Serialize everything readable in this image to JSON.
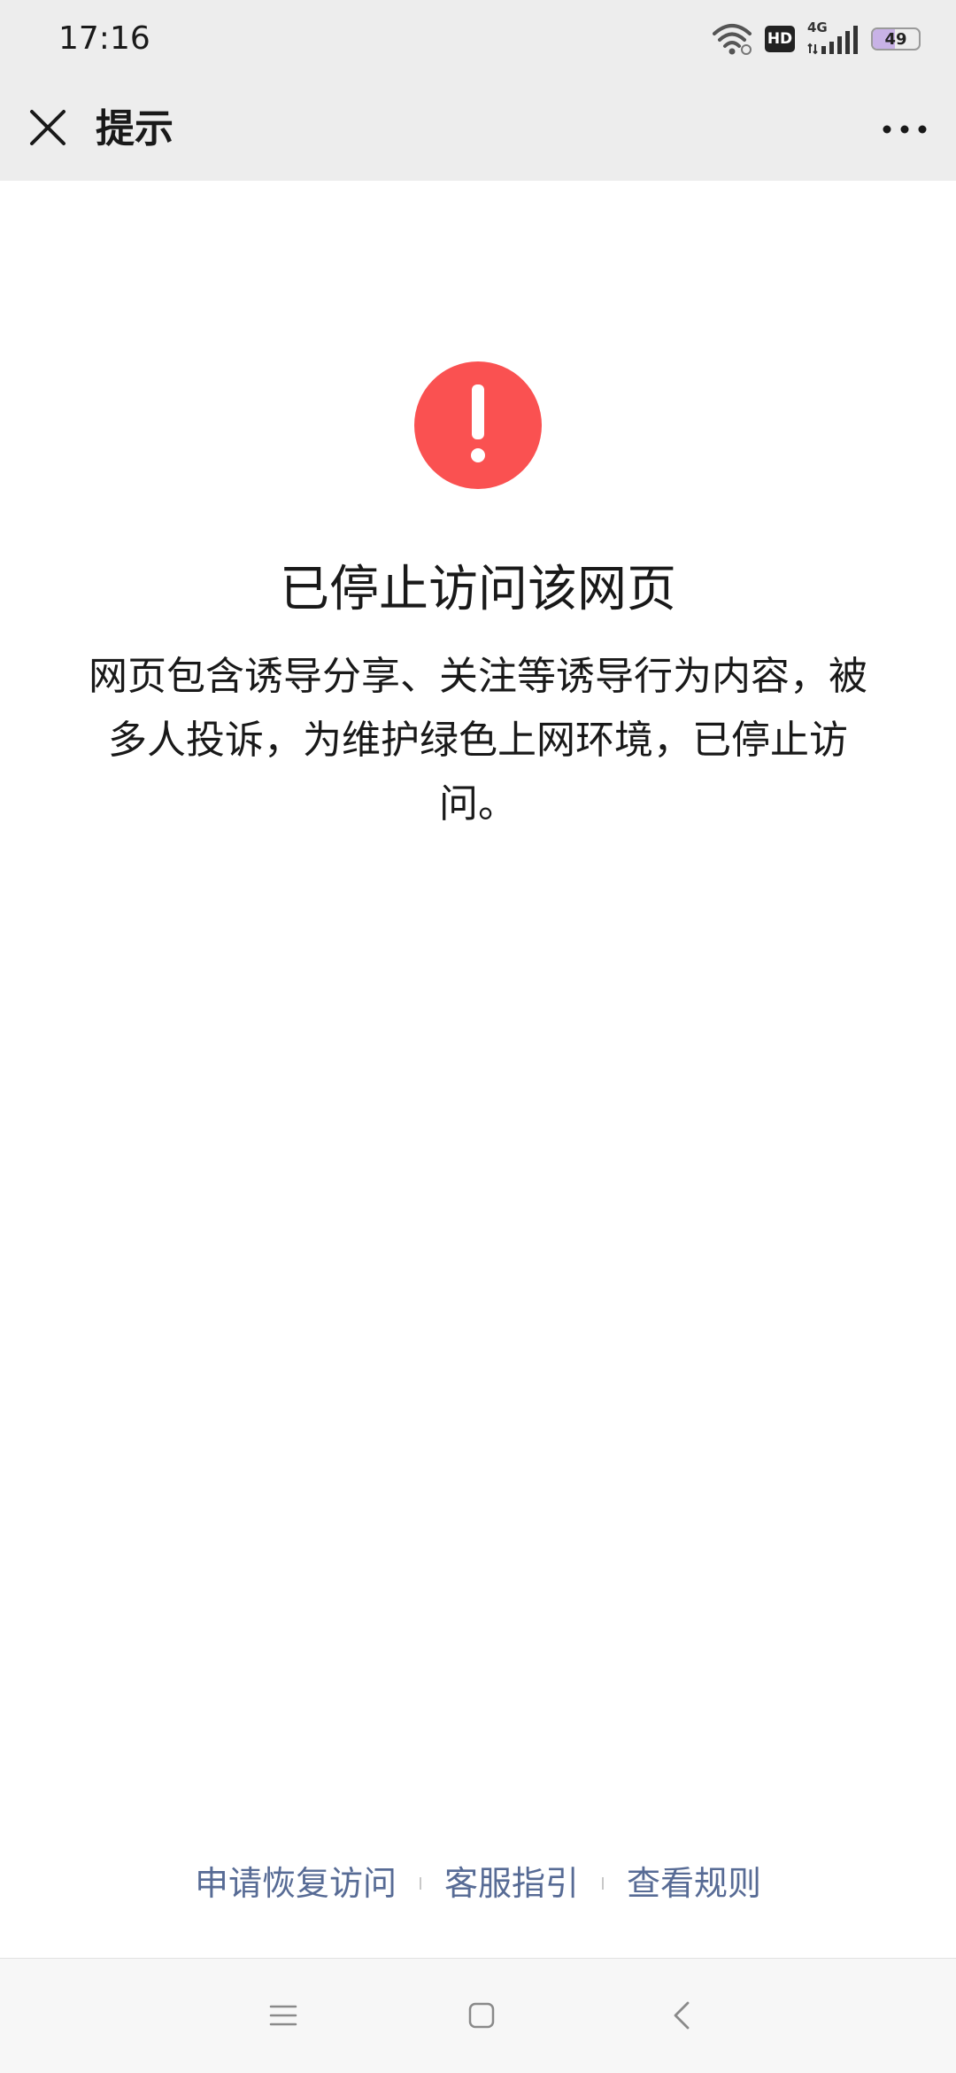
{
  "status_bar": {
    "time": "17:16",
    "hd_label": "HD",
    "network_label": "4G",
    "battery_level": "49"
  },
  "nav": {
    "title": "提示",
    "close_icon": "close-icon",
    "more_icon": "more-horizontal-icon"
  },
  "content": {
    "icon": "exclamation-circle-icon",
    "icon_color": "#fa5151",
    "title": "已停止访问该网页",
    "description": "网页包含诱导分享、关注等诱导行为内容，被多人投诉，为维护绿色上网环境，已停止访问。"
  },
  "footer_links": {
    "appeal": "申请恢复访问",
    "support": "客服指引",
    "rules": "查看规则",
    "link_color": "#576b95"
  },
  "system_nav": {
    "menu_icon": "menu-icon",
    "home_icon": "home-square-icon",
    "back_icon": "back-chevron-icon"
  }
}
